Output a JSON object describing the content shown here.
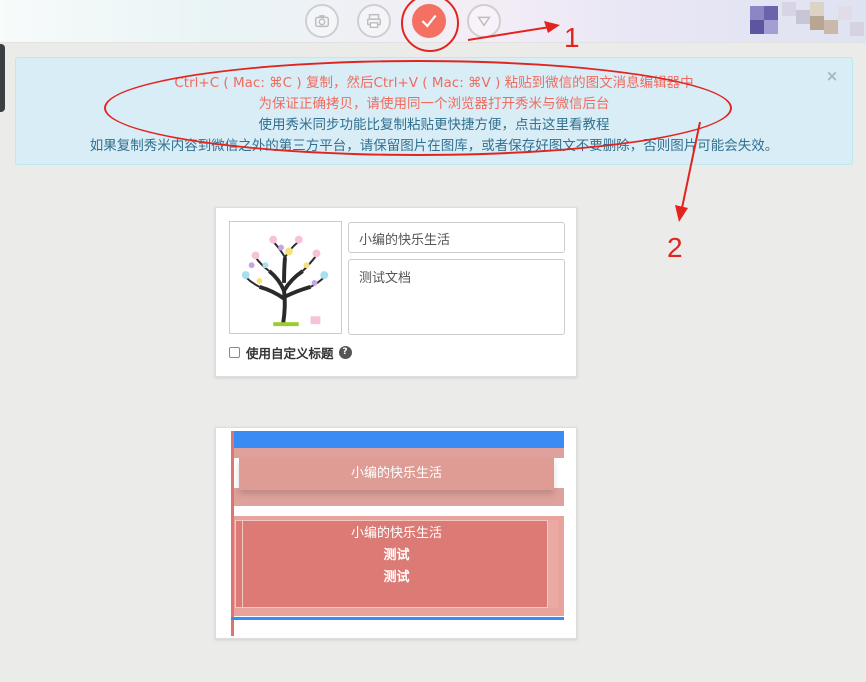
{
  "toolbar": {
    "tools": [
      {
        "name": "camera-tool",
        "active": false
      },
      {
        "name": "print-tool",
        "active": false
      },
      {
        "name": "check-tool",
        "active": true
      },
      {
        "name": "down-tool",
        "active": false
      }
    ]
  },
  "alert": {
    "line1": "Ctrl+C ( Mac: ⌘C ) 复制，然后Ctrl+V ( Mac: ⌘V ) 粘贴到微信的图文消息编辑器中",
    "line2": "为保证正确拷贝，请使用同一个浏览器打开秀米与微信后台",
    "line3": "使用秀米同步功能比复制粘贴更快捷方便，点击这里看教程",
    "line4": "如果复制秀米内容到微信之外的第三方平台，请保留图片在图库，或者保存好图文不要删除，否则图片可能会失效。",
    "close": "×"
  },
  "annotations": {
    "label1": "1",
    "label2": "2",
    "color": "#e3241e"
  },
  "editor": {
    "title_value": "小编的快乐生活",
    "digest_value": "测试文档",
    "custom_title_label": "使用自定义标题",
    "help_glyph": "?"
  },
  "preview": {
    "header_title": "小编的快乐生活",
    "body_lines": [
      "小编的快乐生活",
      "测试",
      "测试"
    ]
  },
  "colors": {
    "accent": "#f47063",
    "alert_bg": "#d9edf7",
    "alert_text": "#31708f",
    "alert_highlight": "#f06b5f"
  }
}
